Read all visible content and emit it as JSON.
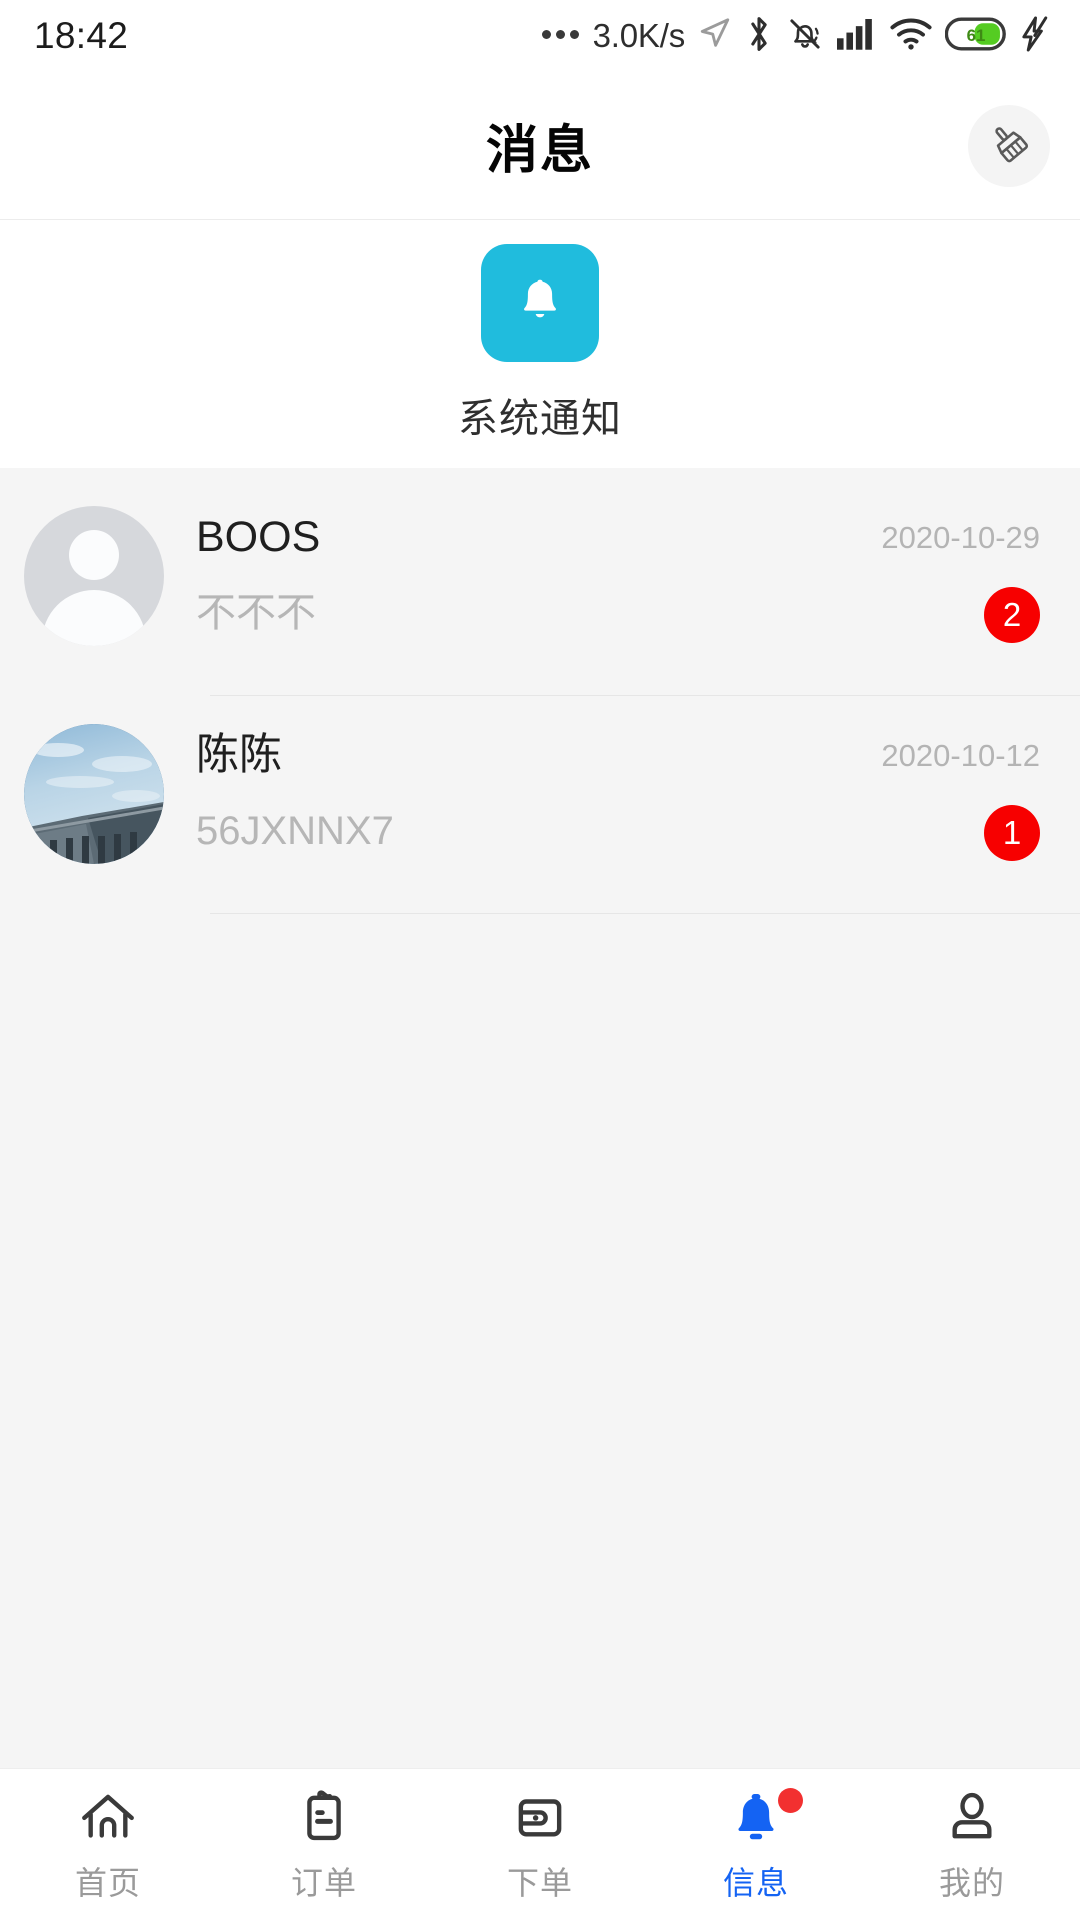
{
  "status_bar": {
    "time": "18:42",
    "network_speed": "3.0K/s",
    "battery_percent": "61",
    "icons": [
      "ellipsis-icon",
      "location-arrow-icon",
      "bluetooth-icon",
      "bell-muted-icon",
      "cellular-signal-icon",
      "wifi-icon",
      "battery-icon",
      "charging-bolt-icon"
    ],
    "battery_color": "#55cc22"
  },
  "header": {
    "title": "消息",
    "action_icon": "broom-clear-icon"
  },
  "notice": {
    "icon": "bell-icon",
    "label": "系统通知",
    "tile_color": "#20bcdd"
  },
  "chats": [
    {
      "name": "BOOS",
      "message": "不不不",
      "date": "2020-10-29",
      "badge": "2",
      "avatar": "default-person-avatar"
    },
    {
      "name": "陈陈",
      "message": "56JXNNX7",
      "date": "2020-10-12",
      "badge": "1",
      "avatar": "dam-landscape-photo-avatar"
    }
  ],
  "badge_color": "#f70000",
  "tabs": [
    {
      "label": "首页",
      "icon": "home-icon",
      "active": false,
      "dot": false
    },
    {
      "label": "订单",
      "icon": "clipboard-icon",
      "active": false,
      "dot": false
    },
    {
      "label": "下单",
      "icon": "wallet-icon",
      "active": false,
      "dot": false
    },
    {
      "label": "信息",
      "icon": "bell-icon",
      "active": true,
      "dot": true
    },
    {
      "label": "我的",
      "icon": "person-icon",
      "active": false,
      "dot": false
    }
  ],
  "active_tab_color": "#1463f3",
  "inactive_tab_color": "#9a9a9a"
}
